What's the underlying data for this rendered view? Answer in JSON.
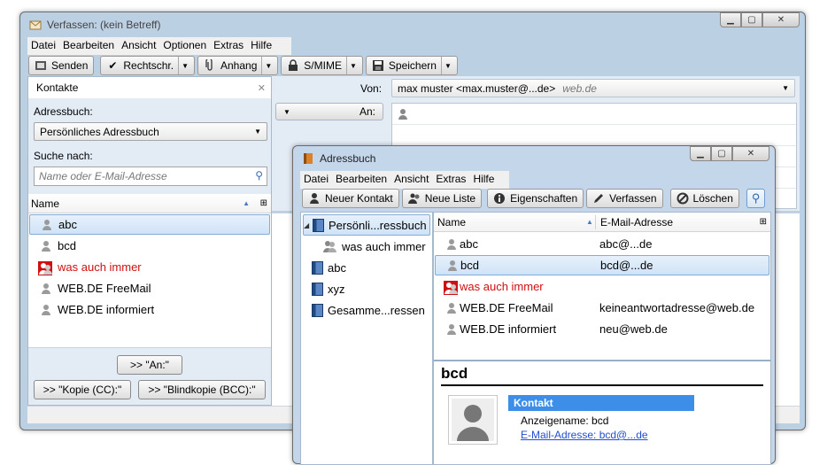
{
  "compose": {
    "title": "Verfassen: (kein Betreff)",
    "menu": [
      "Datei",
      "Bearbeiten",
      "Ansicht",
      "Optionen",
      "Extras",
      "Hilfe"
    ],
    "toolbar": {
      "send": "Senden",
      "spell": "Rechtschr.",
      "attach": "Anhang",
      "smime": "S/MIME",
      "save": "Speichern"
    },
    "contacts_panel": {
      "title": "Kontakte",
      "addressbook_label": "Adressbuch:",
      "addressbook_value": "Persönliches Adressbuch",
      "search_label": "Suche nach:",
      "search_placeholder": "Name oder E-Mail-Adresse",
      "column_name": "Name",
      "items": [
        {
          "label": "abc",
          "type": "person",
          "selected": true
        },
        {
          "label": "bcd",
          "type": "person"
        },
        {
          "label": "was auch immer",
          "type": "list"
        },
        {
          "label": "WEB.DE FreeMail",
          "type": "person"
        },
        {
          "label": "WEB.DE informiert",
          "type": "person"
        }
      ],
      "btn_to": ">> \"An:\"",
      "btn_cc": ">> \"Kopie (CC):\"",
      "btn_bcc": ">> \"Blindkopie (BCC):\""
    },
    "from_label": "Von:",
    "from_value": "max muster <max.muster@...de>",
    "from_domain": "web.de",
    "to_label": "An:"
  },
  "addressbook": {
    "title": "Adressbuch",
    "menu": [
      "Datei",
      "Bearbeiten",
      "Ansicht",
      "Extras",
      "Hilfe"
    ],
    "toolbar": {
      "new_contact": "Neuer Kontakt",
      "new_list": "Neue Liste",
      "properties": "Eigenschaften",
      "compose": "Verfassen",
      "delete": "Löschen"
    },
    "tree": [
      {
        "label": "Persönli...ressbuch",
        "level": 0,
        "selected": true
      },
      {
        "label": "was auch immer",
        "level": 1
      },
      {
        "label": "abc",
        "level": 0
      },
      {
        "label": "xyz",
        "level": 0
      },
      {
        "label": "Gesamme...ressen",
        "level": 0
      }
    ],
    "columns": {
      "name": "Name",
      "email": "E-Mail-Adresse"
    },
    "rows": [
      {
        "name": "abc",
        "email": "abc@...de",
        "type": "person"
      },
      {
        "name": "bcd",
        "email": "bcd@...de",
        "type": "person",
        "selected": true
      },
      {
        "name": "was auch immer",
        "email": "",
        "type": "list"
      },
      {
        "name": "WEB.DE FreeMail",
        "email": "keineantwortadresse@web.de",
        "type": "person"
      },
      {
        "name": "WEB.DE informiert",
        "email": "neu@web.de",
        "type": "person"
      }
    ],
    "detail": {
      "name": "bcd",
      "section": "Kontakt",
      "display_name": "Anzeigename: bcd",
      "email_link": "E-Mail-Adresse: bcd@...de"
    }
  }
}
